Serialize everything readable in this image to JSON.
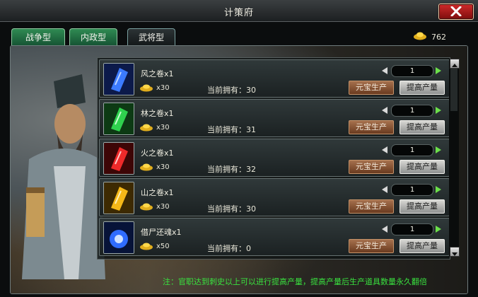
{
  "window": {
    "title": "计策府",
    "close_icon": "close-x-icon"
  },
  "tabs": [
    {
      "label": "战争型",
      "active": true
    },
    {
      "label": "内政型",
      "active": true
    },
    {
      "label": "武将型",
      "active": false
    }
  ],
  "gold": {
    "icon": "gold-ingot-icon",
    "count": "762"
  },
  "items": [
    {
      "name": "风之卷x1",
      "icon": "wind-scroll-icon",
      "color": "#1e4fd8",
      "cost": "x30",
      "owned": "当前拥有：30",
      "qty": "1",
      "produce": "元宝生产",
      "improve": "提高产量"
    },
    {
      "name": "林之卷x1",
      "icon": "forest-scroll-icon",
      "color": "#1fa53a",
      "cost": "x30",
      "owned": "当前拥有：31",
      "qty": "1",
      "produce": "元宝生产",
      "improve": "提高产量"
    },
    {
      "name": "火之卷x1",
      "icon": "fire-scroll-icon",
      "color": "#c81c1c",
      "cost": "x30",
      "owned": "当前拥有：32",
      "qty": "1",
      "produce": "元宝生产",
      "improve": "提高产量"
    },
    {
      "name": "山之卷x1",
      "icon": "mountain-scroll-icon",
      "color": "#e0a010",
      "cost": "x30",
      "owned": "当前拥有：30",
      "qty": "1",
      "produce": "元宝生产",
      "improve": "提高产量"
    },
    {
      "name": "借尸还魂x1",
      "icon": "soul-orb-icon",
      "color": "#2a64e8",
      "cost": "x50",
      "owned": "当前拥有：0",
      "qty": "1",
      "produce": "元宝生产",
      "improve": "提高产量"
    }
  ],
  "note": "注：官职达到刺史以上可以进行提高产量，提高产量后生产道具数量永久翻倍"
}
